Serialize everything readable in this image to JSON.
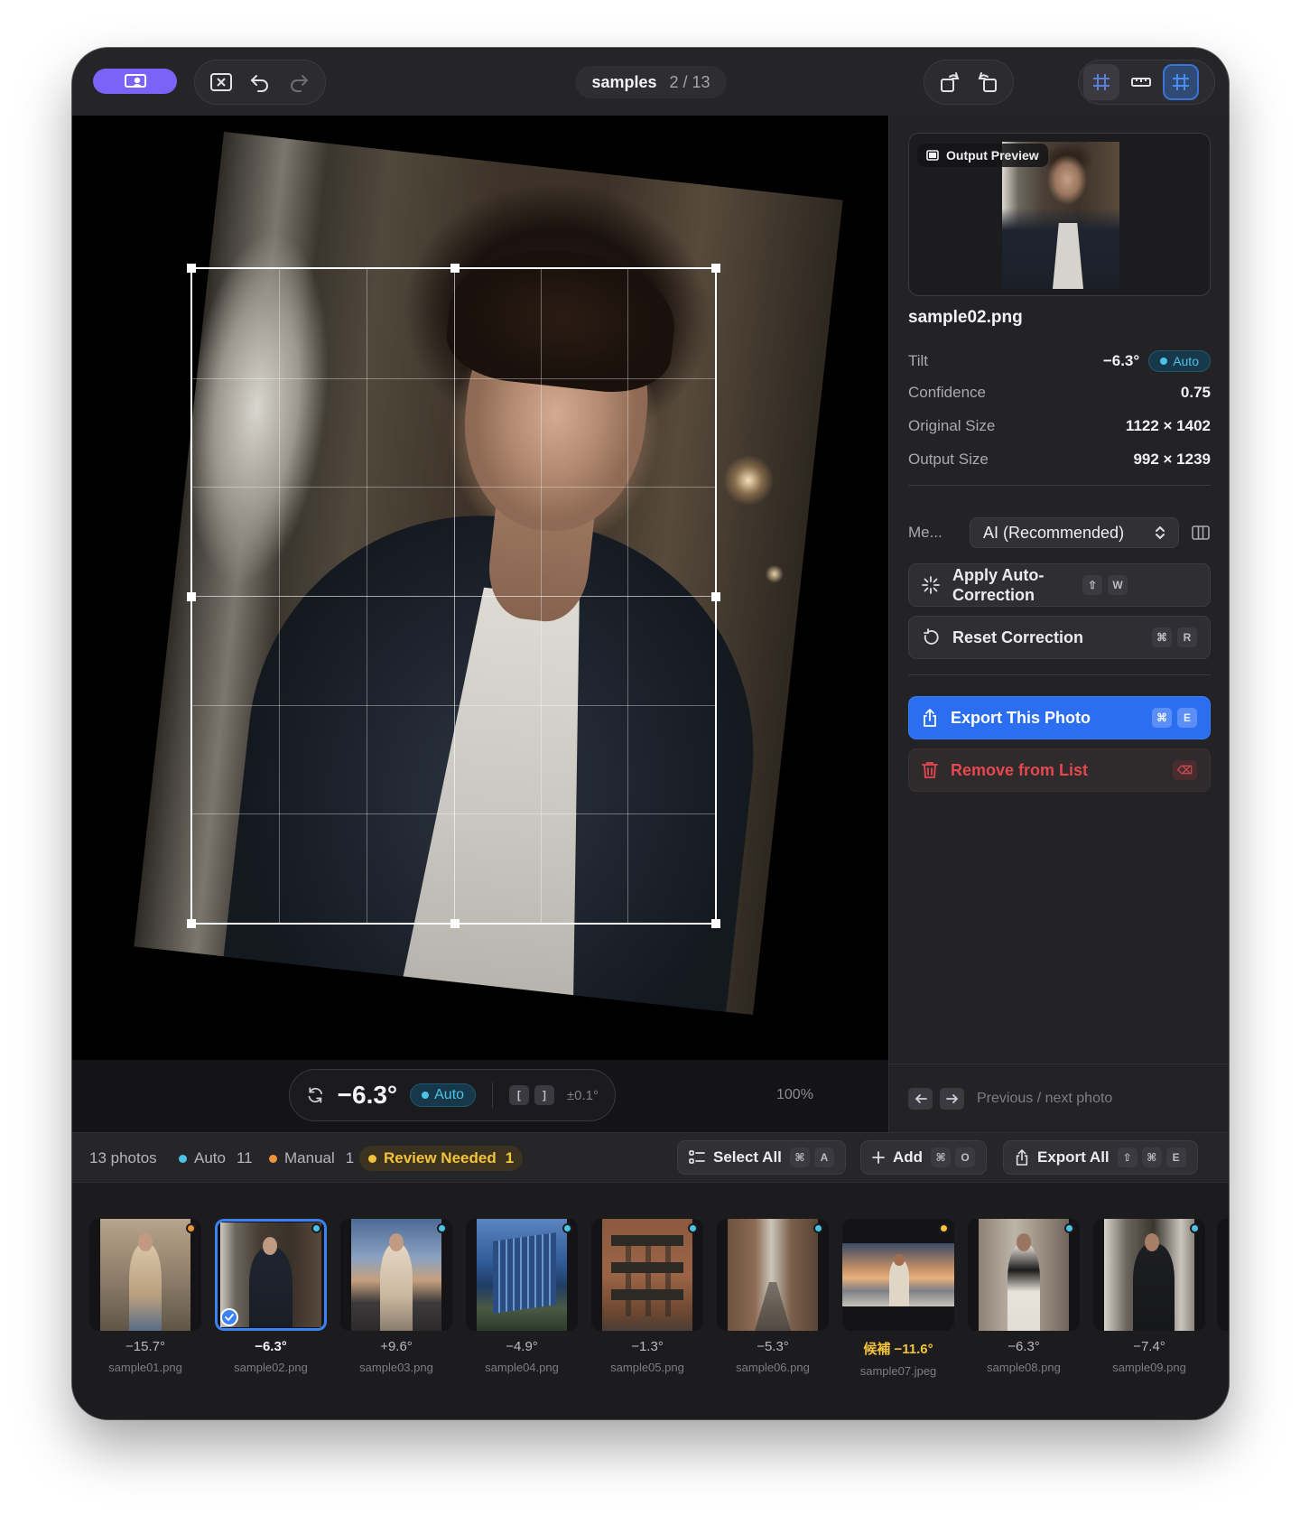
{
  "toolbar": {
    "title": "samples",
    "counter": "2 / 13"
  },
  "canvas": {
    "rotation": "−6.3°",
    "mode_badge": "Auto",
    "key_left": "[",
    "key_right": "]",
    "step": "±0.1°",
    "zoom": "100%"
  },
  "panel": {
    "preview_label": "Output Preview",
    "filename": "sample02.png",
    "rows": [
      {
        "label": "Tilt",
        "value": "−6.3°",
        "badge": "Auto"
      },
      {
        "label": "Confidence",
        "value": "0.75"
      },
      {
        "label": "Original Size",
        "value": "1122 × 1402"
      },
      {
        "label": "Output Size",
        "value": "992 × 1239"
      }
    ],
    "method_label": "Me...",
    "method_value": "AI (Recommended)",
    "apply_label": "Apply Auto-Correction",
    "apply_keys": [
      "⇧",
      "W"
    ],
    "reset_label": "Reset Correction",
    "reset_keys": [
      "⌘",
      "R"
    ],
    "export_label": "Export This Photo",
    "export_keys": [
      "⌘",
      "E"
    ],
    "remove_label": "Remove from List",
    "nav_hint": "Previous / next photo"
  },
  "statusbar": {
    "photos": "13 photos",
    "auto_label": "Auto",
    "auto_count": "11",
    "manual_label": "Manual",
    "manual_count": "1",
    "review_label": "Review Needed",
    "review_count": "1",
    "select_all": "Select All",
    "select_keys": [
      "⌘",
      "A"
    ],
    "add": "Add",
    "add_keys": [
      "⌘",
      "O"
    ],
    "export_all": "Export All",
    "export_keys": [
      "⇧",
      "⌘",
      "E"
    ]
  },
  "colors": {
    "accent": "#7b63f7",
    "primary_blue": "#2c6ef2",
    "auto_cyan": "#4cc3e6",
    "manual_orange": "#f0943b",
    "review_yellow": "#f2c33b",
    "danger_red": "#e5484f"
  },
  "filmstrip": [
    {
      "angle": "−15.7°",
      "file": "sample01.png",
      "status": "manual",
      "selected": false
    },
    {
      "angle": "−6.3°",
      "file": "sample02.png",
      "status": "auto",
      "selected": true
    },
    {
      "angle": "+9.6°",
      "file": "sample03.png",
      "status": "auto",
      "selected": false
    },
    {
      "angle": "−4.9°",
      "file": "sample04.png",
      "status": "auto",
      "selected": false
    },
    {
      "angle": "−1.3°",
      "file": "sample05.png",
      "status": "auto",
      "selected": false
    },
    {
      "angle": "−5.3°",
      "file": "sample06.png",
      "status": "auto",
      "selected": false
    },
    {
      "angle": "候補 −11.6°",
      "file": "sample07.jpeg",
      "status": "review",
      "selected": false
    },
    {
      "angle": "−6.3°",
      "file": "sample08.png",
      "status": "auto",
      "selected": false
    },
    {
      "angle": "−7.4°",
      "file": "sample09.png",
      "status": "auto",
      "selected": false
    }
  ]
}
